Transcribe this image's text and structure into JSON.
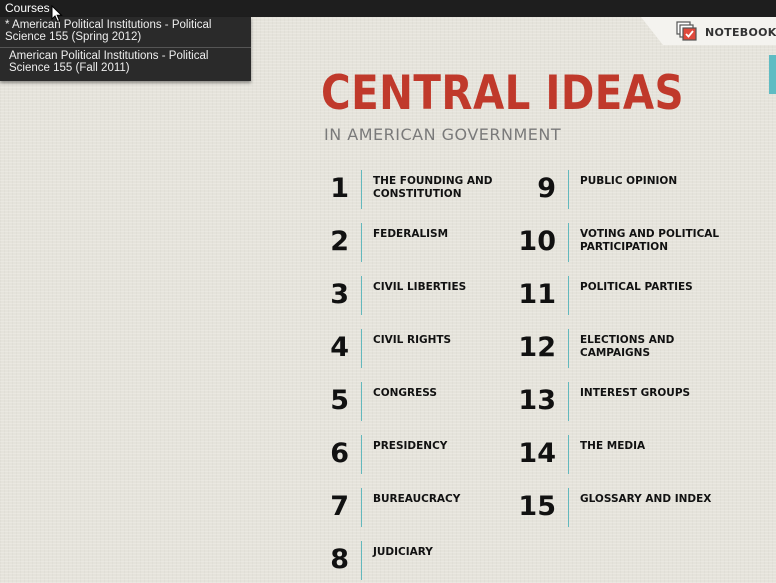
{
  "menubar": {
    "courses_label": "Courses"
  },
  "courses_dropdown": {
    "items": [
      "* American Political Institutions - Political Science 155 (Spring 2012)",
      "American Political Institutions - Political Science 155 (Fall 2011)"
    ]
  },
  "notebook": {
    "label": "NOTEBOOK"
  },
  "header": {
    "title": "CENTRAL IDEAS",
    "subtitle": "IN AMERICAN GOVERNMENT"
  },
  "colors": {
    "title_red": "#c0392b",
    "accent_teal": "#62b8bd",
    "notebook_check": "#e0493b"
  },
  "chapters": [
    {
      "num": "1",
      "title": "THE FOUNDING AND CONSTITUTION"
    },
    {
      "num": "2",
      "title": "FEDERALISM"
    },
    {
      "num": "3",
      "title": "CIVIL LIBERTIES"
    },
    {
      "num": "4",
      "title": "CIVIL RIGHTS"
    },
    {
      "num": "5",
      "title": "CONGRESS"
    },
    {
      "num": "6",
      "title": "PRESIDENCY"
    },
    {
      "num": "7",
      "title": "BUREAUCRACY"
    },
    {
      "num": "8",
      "title": "JUDICIARY"
    },
    {
      "num": "9",
      "title": "PUBLIC OPINION"
    },
    {
      "num": "10",
      "title": "VOTING AND POLITICAL PARTICIPATION"
    },
    {
      "num": "11",
      "title": "POLITICAL PARTIES"
    },
    {
      "num": "12",
      "title": "ELECTIONS AND CAMPAIGNS"
    },
    {
      "num": "13",
      "title": "INTEREST GROUPS"
    },
    {
      "num": "14",
      "title": "THE MEDIA"
    },
    {
      "num": "15",
      "title": "GLOSSARY AND INDEX"
    }
  ]
}
